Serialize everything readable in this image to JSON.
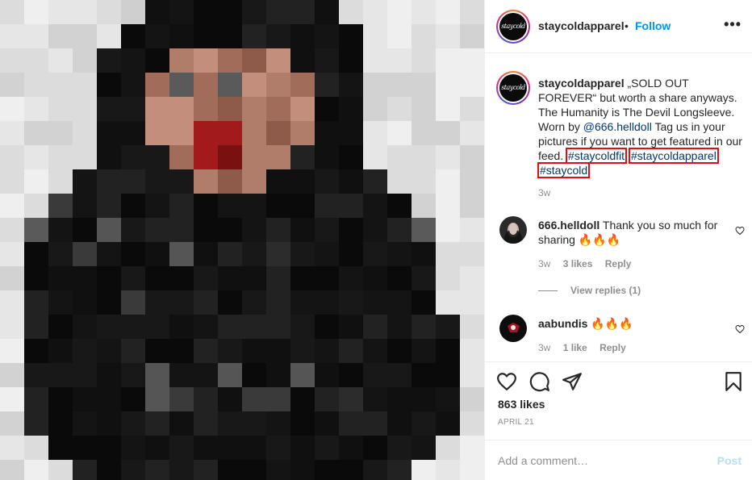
{
  "post": {
    "author": "staycoldapparel",
    "follow_label": "Follow",
    "separator": "•",
    "more_label": "•••",
    "avatar_text": "staycold",
    "caption": {
      "text_part1": "„SOLD OUT FOREVER“ but worth a share anyways. The Humanity is The Devil Longsleeve. Worn by",
      "mention": "@666.helldoll",
      "text_part2": "Tag us in your pictures if you want to get featured in our feed.",
      "tags": [
        "#staycoldfit",
        "#staycoldapparel",
        "#staycold"
      ],
      "time": "3w"
    },
    "likes": "863 likes",
    "date": "APRIL 21"
  },
  "comments": [
    {
      "user": "666.helldoll",
      "text": "Thank you so much for sharing 🔥🔥🔥",
      "time": "3w",
      "likes": "3 likes",
      "reply": "Reply"
    },
    {
      "user": "aabundis",
      "text": "🔥🔥🔥",
      "time": "3w",
      "likes": "1 like",
      "reply": "Reply"
    }
  ],
  "view_replies": "View replies (1)",
  "comment_box": {
    "placeholder": "Add a comment…",
    "post_label": "Post"
  },
  "icons": {
    "like": "heart-icon",
    "comment": "comment-bubble-icon",
    "share": "paper-plane-icon",
    "save": "bookmark-icon",
    "more": "more-dots-icon"
  },
  "colors": {
    "link": "#0095f6",
    "hashtag": "#00376b",
    "highlight_box": "#e01010",
    "muted": "#8e8e8e"
  }
}
